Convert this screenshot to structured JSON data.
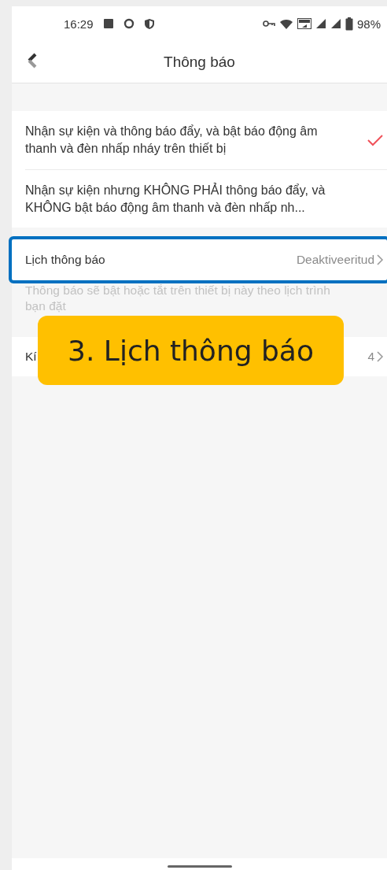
{
  "status_bar": {
    "time": "16:29",
    "battery": "98%"
  },
  "header": {
    "title": "Thông báo"
  },
  "options": [
    {
      "text": "Nhận sự kiện và thông báo đẩy, và bật báo động âm thanh và đèn nhấp nháy trên thiết bị",
      "selected": true
    },
    {
      "text": "Nhận sự kiện nhưng KHÔNG PHẢI thông báo đẩy, và KHÔNG bật báo động âm thanh và đèn nhấp nh...",
      "selected": false
    }
  ],
  "schedule": {
    "label": "Lịch thông báo",
    "value": "Deaktiveeritud",
    "highlighted": true,
    "note": "Thông báo sẽ bật hoặc tắt trên thiết bị này theo lịch trình bạn đặt"
  },
  "settings": [
    {
      "label": "Kí",
      "value": "4"
    }
  ],
  "callout": {
    "text": "3. Lịch thông báo"
  }
}
